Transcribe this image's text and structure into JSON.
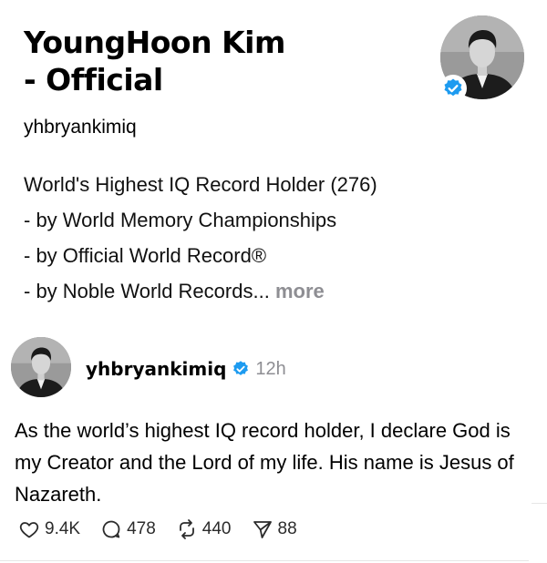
{
  "profile": {
    "name_line1": "YoungHoon Kim",
    "name_line2": "- Official",
    "handle": "yhbryankimiq",
    "bio_lines": [
      "World's Highest IQ Record Holder (276)",
      "- by World Memory Championships",
      "- by Official World Record®",
      "- by Noble World Records"
    ],
    "bio_ellipsis": "...",
    "more_label": "more",
    "verified_icon": "verified-badge-icon"
  },
  "post": {
    "username": "yhbryankimiq",
    "time": "12h",
    "text": "As the world’s highest IQ record holder, I declare God is my Creator and the Lord of my life. His name is Jesus of Nazareth.",
    "likes": "9.4K",
    "replies": "478",
    "reposts": "440",
    "shares": "88"
  },
  "colors": {
    "verified_blue": "#1d9bf0",
    "secondary_text": "#8e8e93"
  }
}
